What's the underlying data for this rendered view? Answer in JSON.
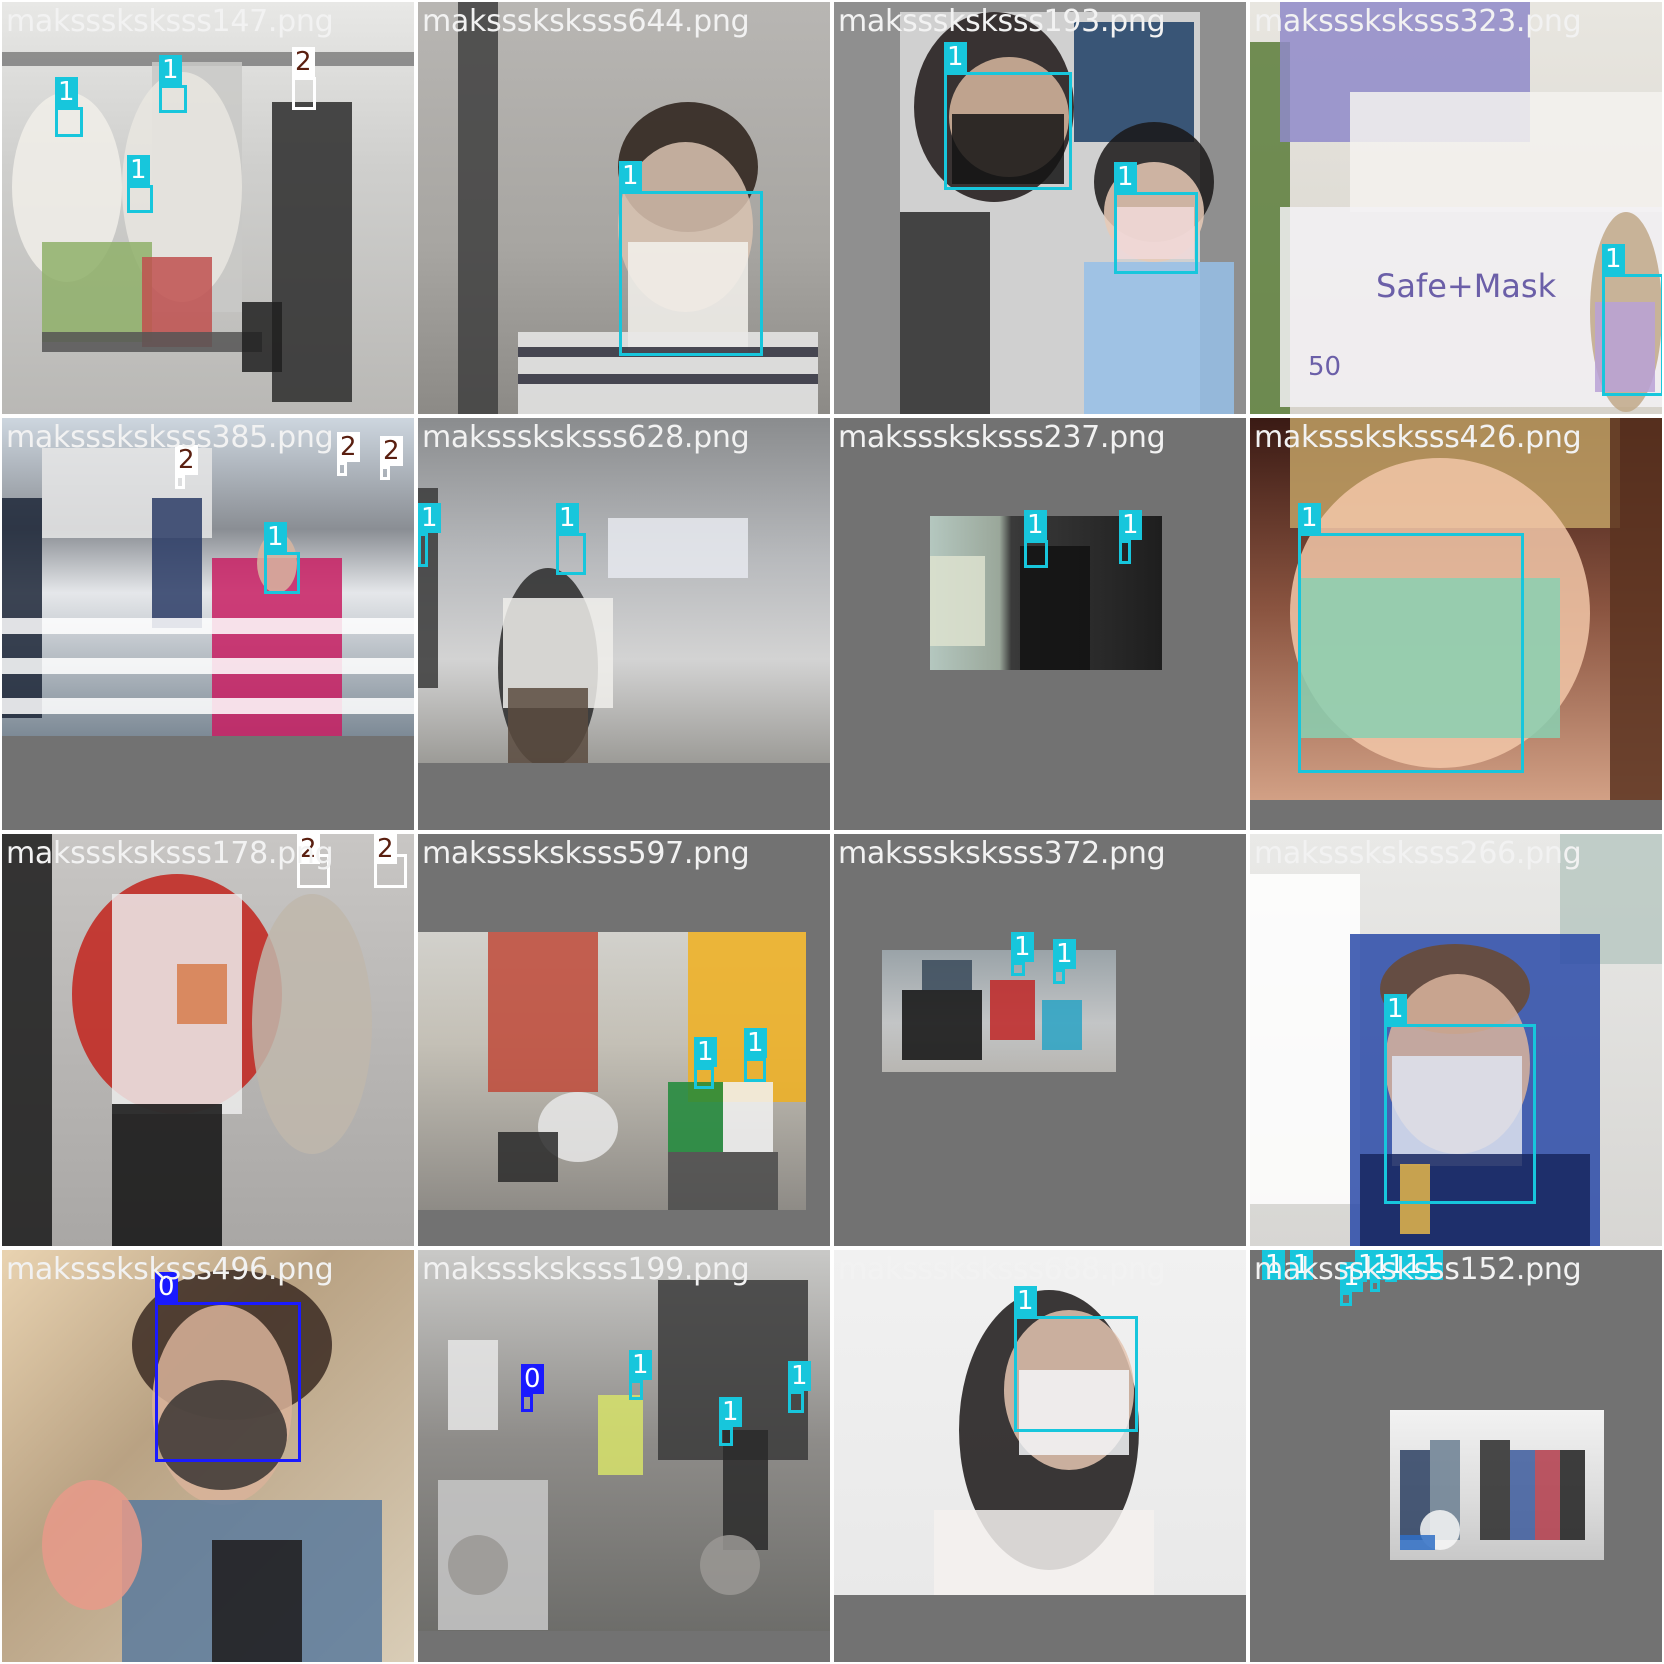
{
  "class_colors": {
    "0": "#1a1aff",
    "1": "#17c6dc",
    "2": "#ffffff"
  },
  "label_text_colors": {
    "0": "#ffffff",
    "1": "#ffffff",
    "2": "#5a1f10"
  },
  "tiles": [
    {
      "filename": "maksssksksss147.png",
      "boxes": [
        {
          "cls": "1"
        },
        {
          "cls": "1"
        },
        {
          "cls": "1"
        },
        {
          "cls": "2"
        }
      ]
    },
    {
      "filename": "maksssksksss644.png",
      "boxes": [
        {
          "cls": "1"
        }
      ]
    },
    {
      "filename": "maksssksksss193.png",
      "boxes": [
        {
          "cls": "1"
        },
        {
          "cls": "1"
        }
      ]
    },
    {
      "filename": "maksssksksss323.png",
      "boxes": [
        {
          "cls": "1"
        }
      ],
      "scene_text": {
        "brand": "Safe+Mask",
        "count": "50"
      }
    },
    {
      "filename": "maksssksksss385.png",
      "boxes": [
        {
          "cls": "2"
        },
        {
          "cls": "2"
        },
        {
          "cls": "2"
        },
        {
          "cls": "1"
        }
      ]
    },
    {
      "filename": "maksssksksss628.png",
      "boxes": [
        {
          "cls": "1"
        },
        {
          "cls": "1"
        }
      ]
    },
    {
      "filename": "maksssksksss237.png",
      "boxes": [
        {
          "cls": "1"
        },
        {
          "cls": "1"
        }
      ]
    },
    {
      "filename": "maksssksksss426.png",
      "boxes": [
        {
          "cls": "1"
        }
      ]
    },
    {
      "filename": "maksssksksss178.png",
      "boxes": [
        {
          "cls": "2"
        },
        {
          "cls": "2"
        }
      ]
    },
    {
      "filename": "maksssksksss597.png",
      "boxes": [
        {
          "cls": "1"
        },
        {
          "cls": "1"
        }
      ]
    },
    {
      "filename": "maksssksksss372.png",
      "boxes": [
        {
          "cls": "1"
        },
        {
          "cls": "1"
        }
      ]
    },
    {
      "filename": "maksssksksss266.png",
      "boxes": [
        {
          "cls": "1"
        }
      ]
    },
    {
      "filename": "maksssksksss496.png",
      "boxes": [
        {
          "cls": "0"
        }
      ]
    },
    {
      "filename": "maksssksksss199.png",
      "boxes": [
        {
          "cls": "0"
        },
        {
          "cls": "1"
        },
        {
          "cls": "1"
        },
        {
          "cls": "1"
        }
      ]
    },
    {
      "filename": "maksssksksss688.png",
      "boxes": [
        {
          "cls": "1"
        }
      ]
    },
    {
      "filename": "maksssksksss152.png",
      "boxes": [
        {
          "cls": "1"
        },
        {
          "cls": "1"
        },
        {
          "cls": "1"
        },
        {
          "cls": "1"
        },
        {
          "cls": "1"
        },
        {
          "cls": "1"
        },
        {
          "cls": "1"
        },
        {
          "cls": "1"
        }
      ]
    }
  ]
}
